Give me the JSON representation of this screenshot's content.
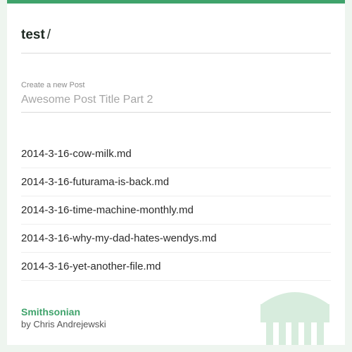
{
  "header": {
    "title": "test",
    "separator": "/"
  },
  "new_post": {
    "label": "Create a new Post",
    "placeholder": "Awesome Post Title Part 2"
  },
  "files": [
    "2014-3-16-cow-milk.md",
    "2014-3-16-futurama-is-back.md",
    "2014-3-16-time-machine-monthly.md",
    "2014-3-16-why-my-dad-hates-wendys.md",
    "2014-3-16-yet-another-file.md"
  ],
  "footer": {
    "title": "Smithsonian",
    "author": "by Chris Andrejewski"
  },
  "icons": {
    "logo": "smithsonian-building-icon"
  },
  "colors": {
    "accent": "#3fa36b",
    "logo": "#d7ecdd",
    "background": "#eef5ef"
  }
}
